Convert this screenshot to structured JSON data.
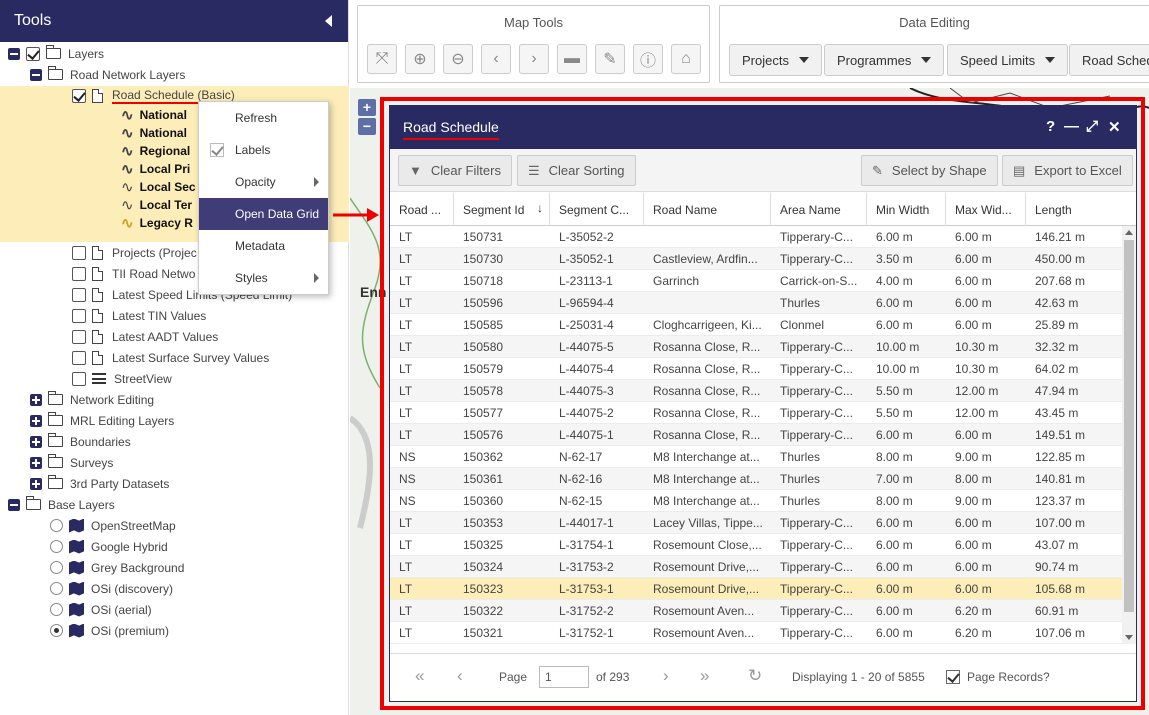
{
  "tools": {
    "title": "Tools",
    "tree": {
      "layers": "Layers",
      "road_network_layers": "Road Network Layers",
      "road_schedule_basic": "Road Schedule (Basic)",
      "sublayers": [
        "National",
        "National",
        "Regional",
        "Local Pri",
        "Local Sec",
        "Local Ter",
        "Legacy R"
      ],
      "projects": "Projects (Projec",
      "tii_road_network": "TII Road Netwo",
      "latest_speed_limits": "Latest Speed Limits (Speed Limit)",
      "latest_tin": "Latest TIN Values",
      "latest_aadt": "Latest AADT Values",
      "latest_surface": "Latest Surface Survey Values",
      "streetview": "StreetView",
      "network_editing": "Network Editing",
      "mrl_editing": "MRL Editing Layers",
      "boundaries": "Boundaries",
      "surveys": "Surveys",
      "third_party": "3rd Party Datasets",
      "base_layers": "Base Layers",
      "base": [
        "OpenStreetMap",
        "Google Hybrid",
        "Grey Background",
        "OSi (discovery)",
        "OSi (aerial)",
        "OSi (premium)"
      ]
    }
  },
  "context_menu": {
    "items": [
      "Refresh",
      "Labels",
      "Opacity",
      "Open Data Grid",
      "Metadata",
      "Styles"
    ]
  },
  "map_tools": {
    "title": "Map Tools",
    "icons": [
      "expand-icon",
      "zoom-in-icon",
      "zoom-out-icon",
      "prev-extent-icon",
      "next-extent-icon",
      "measure-icon",
      "edit-icon",
      "identify-icon",
      "home-icon"
    ]
  },
  "data_editing": {
    "title": "Data Editing",
    "buttons": [
      "Projects",
      "Programmes",
      "Speed Limits",
      "Road Schedu"
    ]
  },
  "map": {
    "town_label": "Enn",
    "zoom_in": "+",
    "zoom_out": "−"
  },
  "window": {
    "title": "Road Schedule",
    "controls": [
      "?",
      "—",
      "⤢",
      "✕"
    ],
    "toolbar": {
      "clear_filters": "Clear Filters",
      "clear_sorting": "Clear Sorting",
      "select_by_shape": "Select by Shape",
      "export_excel": "Export to Excel"
    },
    "columns": [
      "Road ...",
      "Segment Id",
      "Segment C...",
      "Road Name",
      "Area Name",
      "Min Width",
      "Max Wid...",
      "Length"
    ],
    "rows": [
      [
        "LT",
        "150731",
        "L-35052-2",
        "",
        "Tipperary-C...",
        "6.00 m",
        "6.00 m",
        "146.21 m"
      ],
      [
        "LT",
        "150730",
        "L-35052-1",
        "Castleview, Ardfin...",
        "Tipperary-C...",
        "3.50 m",
        "6.00 m",
        "450.00 m"
      ],
      [
        "LT",
        "150718",
        "L-23113-1",
        "Garrinch",
        "Carrick-on-S...",
        "4.00 m",
        "6.00 m",
        "207.68 m"
      ],
      [
        "LT",
        "150596",
        "L-96594-4",
        "",
        "Thurles",
        "6.00 m",
        "6.00 m",
        "42.63 m"
      ],
      [
        "LT",
        "150585",
        "L-25031-4",
        "Cloghcarrigeen, Ki...",
        "Clonmel",
        "6.00 m",
        "6.00 m",
        "25.89 m"
      ],
      [
        "LT",
        "150580",
        "L-44075-5",
        "Rosanna Close, R...",
        "Tipperary-C...",
        "10.00 m",
        "10.30 m",
        "32.32 m"
      ],
      [
        "LT",
        "150579",
        "L-44075-4",
        "Rosanna Close, R...",
        "Tipperary-C...",
        "10.00 m",
        "10.30 m",
        "64.02 m"
      ],
      [
        "LT",
        "150578",
        "L-44075-3",
        "Rosanna Close, R...",
        "Tipperary-C...",
        "5.50 m",
        "12.00 m",
        "47.94 m"
      ],
      [
        "LT",
        "150577",
        "L-44075-2",
        "Rosanna Close, R...",
        "Tipperary-C...",
        "5.50 m",
        "12.00 m",
        "43.45 m"
      ],
      [
        "LT",
        "150576",
        "L-44075-1",
        "Rosanna Close, R...",
        "Tipperary-C...",
        "6.00 m",
        "6.00 m",
        "149.51 m"
      ],
      [
        "NS",
        "150362",
        "N-62-17",
        "M8 Interchange at...",
        "Thurles",
        "8.00 m",
        "9.00 m",
        "122.85 m"
      ],
      [
        "NS",
        "150361",
        "N-62-16",
        "M8 Interchange at...",
        "Thurles",
        "7.00 m",
        "8.00 m",
        "140.81 m"
      ],
      [
        "NS",
        "150360",
        "N-62-15",
        "M8 Interchange at...",
        "Thurles",
        "8.00 m",
        "9.00 m",
        "123.37 m"
      ],
      [
        "LT",
        "150353",
        "L-44017-1",
        "Lacey Villas, Tippe...",
        "Tipperary-C...",
        "6.00 m",
        "6.00 m",
        "107.00 m"
      ],
      [
        "LT",
        "150325",
        "L-31754-1",
        "Rosemount Close,...",
        "Tipperary-C...",
        "6.00 m",
        "6.00 m",
        "43.07 m"
      ],
      [
        "LT",
        "150324",
        "L-31753-2",
        "Rosemount Drive,...",
        "Tipperary-C...",
        "6.00 m",
        "6.00 m",
        "90.74 m"
      ],
      [
        "LT",
        "150323",
        "L-31753-1",
        "Rosemount Drive,...",
        "Tipperary-C...",
        "6.00 m",
        "6.00 m",
        "105.68 m"
      ],
      [
        "LT",
        "150322",
        "L-31752-2",
        "Rosemount Aven...",
        "Tipperary-C...",
        "6.00 m",
        "6.20 m",
        "60.91 m"
      ],
      [
        "LT",
        "150321",
        "L-31752-1",
        "Rosemount Aven...",
        "Tipperary-C...",
        "6.00 m",
        "6.20 m",
        "107.06 m"
      ]
    ],
    "selected_row": 16,
    "pager": {
      "page_label": "Page",
      "page_value": "1",
      "of_label": "of 293",
      "displaying": "Displaying 1 - 20 of 5855",
      "page_records": "Page Records?"
    }
  }
}
